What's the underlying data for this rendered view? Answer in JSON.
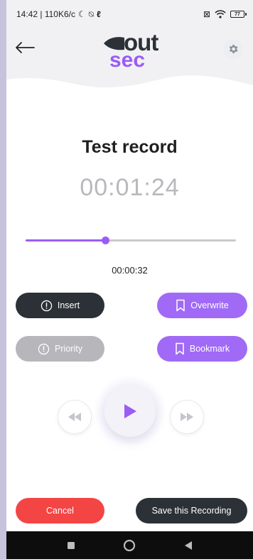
{
  "status_bar": {
    "time_and_speed": "14:42 | 110K6/c",
    "battery_level": "77"
  },
  "header": {
    "logo_top": "out",
    "logo_bottom": "sec"
  },
  "recording": {
    "title": "Test record",
    "duration": "00:01:24",
    "position": "00:00:32",
    "progress_fraction": 0.38
  },
  "actions": {
    "insert_label": "Insert",
    "overwrite_label": "Overwrite",
    "priority_label": "Priority",
    "bookmark_label": "Bookmark"
  },
  "footer": {
    "cancel_label": "Cancel",
    "save_label": "Save this Recording"
  },
  "colors": {
    "accent": "#9b5cf6",
    "dark": "#2b3137",
    "danger": "#f44545",
    "disabled": "#b6b6bb"
  },
  "icons": {
    "back": "arrow-left-icon",
    "settings": "gear-icon",
    "insert": "alert-circle-icon",
    "overwrite": "bookmark-icon",
    "priority": "alert-circle-icon",
    "bookmark": "bookmark-icon",
    "play": "play-icon",
    "rewind": "rewind-icon",
    "forward": "fast-forward-icon"
  }
}
